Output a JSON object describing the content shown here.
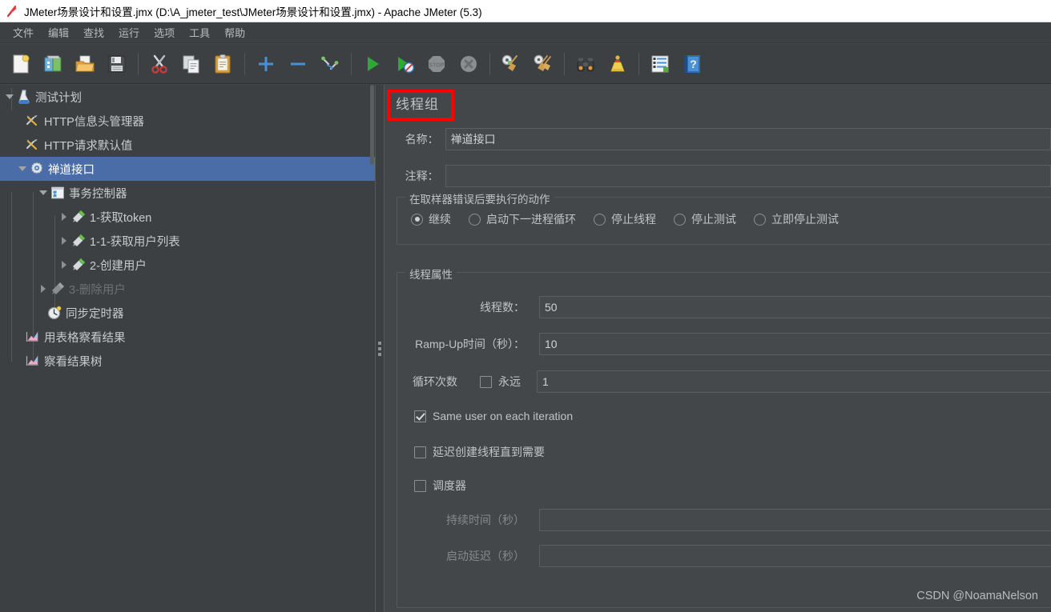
{
  "window": {
    "title": "JMeter场景设计和设置.jmx (D:\\A_jmeter_test\\JMeter场景设计和设置.jmx) - Apache JMeter (5.3)",
    "app_icon": "jmeter-feather-icon"
  },
  "menubar": {
    "items": [
      {
        "label": "文件",
        "name": "menu-file"
      },
      {
        "label": "编辑",
        "name": "menu-edit"
      },
      {
        "label": "查找",
        "name": "menu-search"
      },
      {
        "label": "运行",
        "name": "menu-run"
      },
      {
        "label": "选项",
        "name": "menu-options"
      },
      {
        "label": "工具",
        "name": "menu-tools"
      },
      {
        "label": "帮助",
        "name": "menu-help"
      }
    ]
  },
  "toolbar": {
    "buttons": [
      {
        "icon": "new-document-icon",
        "name": "toolbar-new"
      },
      {
        "icon": "templates-icon",
        "name": "toolbar-templates"
      },
      {
        "icon": "open-folder-icon",
        "name": "toolbar-open"
      },
      {
        "icon": "save-floppy-icon",
        "name": "toolbar-save"
      },
      {
        "sep": true
      },
      {
        "icon": "cut-scissors-icon",
        "name": "toolbar-cut"
      },
      {
        "icon": "copy-pages-icon",
        "name": "toolbar-copy"
      },
      {
        "icon": "paste-clipboard-icon",
        "name": "toolbar-paste"
      },
      {
        "sep": true
      },
      {
        "icon": "expand-plus-icon",
        "name": "toolbar-expand-all"
      },
      {
        "icon": "collapse-minus-icon",
        "name": "toolbar-collapse-all"
      },
      {
        "icon": "toggle-enable-icon",
        "name": "toolbar-toggle"
      },
      {
        "sep": true
      },
      {
        "icon": "start-play-icon",
        "name": "toolbar-start"
      },
      {
        "icon": "start-no-timers-icon",
        "name": "toolbar-start-no-pauses"
      },
      {
        "icon": "stop-icon",
        "name": "toolbar-stop"
      },
      {
        "icon": "shutdown-icon",
        "name": "toolbar-shutdown"
      },
      {
        "sep": true
      },
      {
        "icon": "clear-broom-icon",
        "name": "toolbar-clear"
      },
      {
        "icon": "clear-all-broom-icon",
        "name": "toolbar-clear-all"
      },
      {
        "sep": true
      },
      {
        "icon": "binoculars-search-icon",
        "name": "toolbar-search"
      },
      {
        "icon": "reset-search-broom-icon",
        "name": "toolbar-reset-search"
      },
      {
        "sep": true
      },
      {
        "icon": "function-helper-icon",
        "name": "toolbar-function-helper"
      },
      {
        "icon": "help-book-icon",
        "name": "toolbar-help"
      }
    ]
  },
  "tree": {
    "nodes": [
      {
        "label": "测试计划",
        "icon": "test-plan-icon",
        "depth": 0,
        "expander": "down",
        "selected": false,
        "disabled": false,
        "name": "tree-node-test-plan"
      },
      {
        "label": "HTTP信息头管理器",
        "icon": "header-manager-icon",
        "depth": 1,
        "expander": "none",
        "selected": false,
        "disabled": false,
        "name": "tree-node-http-header-manager"
      },
      {
        "label": "HTTP请求默认值",
        "icon": "http-defaults-icon",
        "depth": 1,
        "expander": "none",
        "selected": false,
        "disabled": false,
        "name": "tree-node-http-request-defaults"
      },
      {
        "label": "禅道接口",
        "icon": "thread-group-icon",
        "depth": 1,
        "expander": "down",
        "selected": true,
        "disabled": false,
        "name": "tree-node-thread-group"
      },
      {
        "label": "事务控制器",
        "icon": "transaction-controller-icon",
        "depth": 2,
        "expander": "down",
        "selected": false,
        "disabled": false,
        "name": "tree-node-transaction-controller"
      },
      {
        "label": "1-获取token",
        "icon": "http-sampler-icon",
        "depth": 3,
        "expander": "right",
        "selected": false,
        "disabled": false,
        "name": "tree-node-sampler-get-token"
      },
      {
        "label": "1-1-获取用户列表",
        "icon": "http-sampler-icon",
        "depth": 3,
        "expander": "right",
        "selected": false,
        "disabled": false,
        "name": "tree-node-sampler-get-user-list"
      },
      {
        "label": "2-创建用户",
        "icon": "http-sampler-icon",
        "depth": 3,
        "expander": "right",
        "selected": false,
        "disabled": false,
        "name": "tree-node-sampler-create-user"
      },
      {
        "label": "3-删除用户",
        "icon": "http-sampler-disabled-icon",
        "depth": 2,
        "expander": "right",
        "selected": false,
        "disabled": true,
        "name": "tree-node-sampler-delete-user"
      },
      {
        "label": "同步定时器",
        "icon": "sync-timer-icon",
        "depth": 2,
        "expander": "none",
        "selected": false,
        "disabled": false,
        "name": "tree-node-sync-timer"
      },
      {
        "label": "用表格察看结果",
        "icon": "view-results-table-icon",
        "depth": 1,
        "expander": "none",
        "selected": false,
        "disabled": false,
        "name": "tree-node-view-results-in-table"
      },
      {
        "label": "察看结果树",
        "icon": "view-results-tree-icon",
        "depth": 1,
        "expander": "none",
        "selected": false,
        "disabled": false,
        "name": "tree-node-view-results-tree"
      }
    ]
  },
  "panel": {
    "title": "线程组",
    "name_label": "名称：",
    "name_value": "禅道接口",
    "comment_label": "注释：",
    "comment_value": "",
    "error_action": {
      "group_title": "在取样器错误后要执行的动作",
      "options": [
        {
          "label": "继续",
          "checked": true,
          "name": "radio-continue"
        },
        {
          "label": "启动下一进程循环",
          "checked": false,
          "name": "radio-start-next-thread-loop"
        },
        {
          "label": "停止线程",
          "checked": false,
          "name": "radio-stop-thread"
        },
        {
          "label": "停止测试",
          "checked": false,
          "name": "radio-stop-test"
        },
        {
          "label": "立即停止测试",
          "checked": false,
          "name": "radio-stop-test-now"
        }
      ]
    },
    "thread_properties": {
      "group_title": "线程属性",
      "num_threads_label": "线程数：",
      "num_threads_value": "50",
      "ramp_up_label": "Ramp-Up时间（秒）：",
      "ramp_up_value": "10",
      "loop_count_label": "循环次数",
      "forever_label": "永远",
      "forever_checked": false,
      "loop_count_value": "1",
      "same_user_label": "Same user on each iteration",
      "same_user_checked": true,
      "delay_thread_creation_label": "延迟创建线程直到需要",
      "delay_thread_creation_checked": false,
      "scheduler_label": "调度器",
      "scheduler_checked": false,
      "duration_label": "持续时间（秒）",
      "duration_value": "",
      "startup_delay_label": "启动延迟（秒）",
      "startup_delay_value": ""
    }
  },
  "watermark": "CSDN @NoamaNelson",
  "colors": {
    "window_bg": "#43474a",
    "chrome_bg": "#3c4043",
    "titlebar_bg": "#ffffff",
    "selection_blue": "#4a6da7",
    "text": "#c0c4c6",
    "text_dim": "#85898b",
    "highlight_red": "#ff0000",
    "field_bg": "#45494c",
    "field_border": "#5b5f62"
  }
}
